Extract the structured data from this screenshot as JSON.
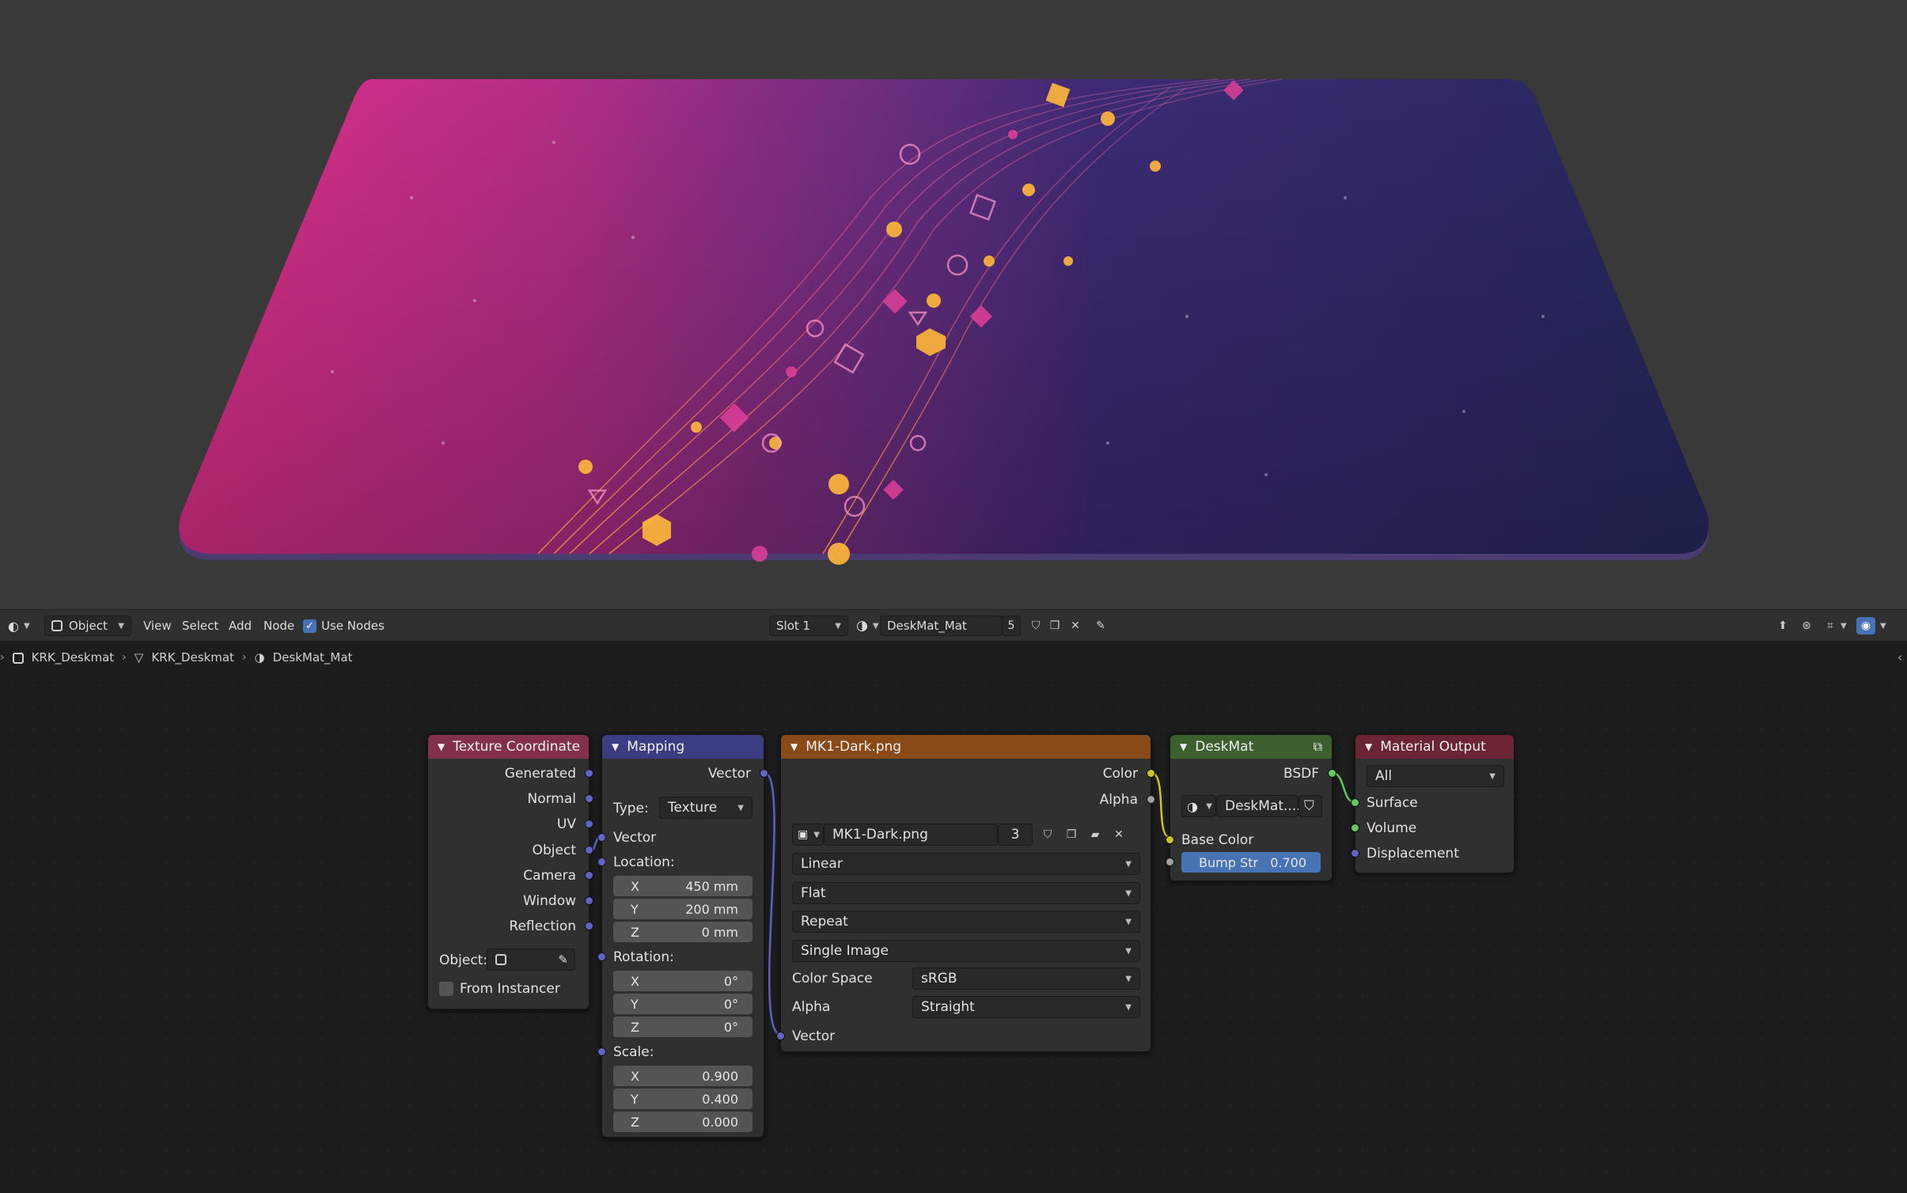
{
  "header": {
    "editor_type_icon": "shader-editor-icon",
    "object_mode": "Object",
    "menus": [
      "View",
      "Select",
      "Add",
      "Node"
    ],
    "use_nodes_label": "Use Nodes",
    "use_nodes_checked": true,
    "slot": "Slot 1",
    "material_name": "DeskMat_Mat",
    "material_users": "5"
  },
  "breadcrumb": {
    "object": "KRK_Deskmat",
    "mesh": "KRK_Deskmat",
    "material": "DeskMat_Mat"
  },
  "nodes": {
    "texcoord": {
      "title": "Texture Coordinate",
      "outputs": [
        "Generated",
        "Normal",
        "UV",
        "Object",
        "Camera",
        "Window",
        "Reflection"
      ],
      "object_label": "Object:",
      "from_instancer": "From Instancer"
    },
    "mapping": {
      "title": "Mapping",
      "output": "Vector",
      "type_label": "Type:",
      "type_value": "Texture",
      "vector_in": "Vector",
      "location_label": "Location:",
      "location": [
        [
          "X",
          "450 mm"
        ],
        [
          "Y",
          "200 mm"
        ],
        [
          "Z",
          "0 mm"
        ]
      ],
      "rotation_label": "Rotation:",
      "rotation": [
        [
          "X",
          "0°"
        ],
        [
          "Y",
          "0°"
        ],
        [
          "Z",
          "0°"
        ]
      ],
      "scale_label": "Scale:",
      "scale": [
        [
          "X",
          "0.900"
        ],
        [
          "Y",
          "0.400"
        ],
        [
          "Z",
          "0.000"
        ]
      ]
    },
    "image": {
      "title": "MK1-Dark.png",
      "out_color": "Color",
      "out_alpha": "Alpha",
      "image_name": "MK1-Dark.png",
      "image_users": "3",
      "interpolation": "Linear",
      "projection": "Flat",
      "extension": "Repeat",
      "source": "Single Image",
      "color_space_label": "Color Space",
      "color_space": "sRGB",
      "alpha_label": "Alpha",
      "alpha_mode": "Straight",
      "vector_in": "Vector"
    },
    "group": {
      "title": "DeskMat",
      "out_bsdf": "BSDF",
      "datablock": "DeskMat....",
      "base_color": "Base Color",
      "bump_label": "Bump Str",
      "bump_value": "0.700"
    },
    "output": {
      "title": "Material Output",
      "target": "All",
      "inputs": [
        "Surface",
        "Volume",
        "Displacement"
      ]
    }
  },
  "colors": {
    "texcoord_header": "#83314a",
    "mapping_header": "#3c3c83",
    "image_header": "#8a4a17",
    "group_header": "#3b5f2d",
    "output_header": "#6b2434",
    "vector_socket": "#6363c7",
    "color_socket": "#c7c729",
    "shader_socket": "#63c763"
  }
}
